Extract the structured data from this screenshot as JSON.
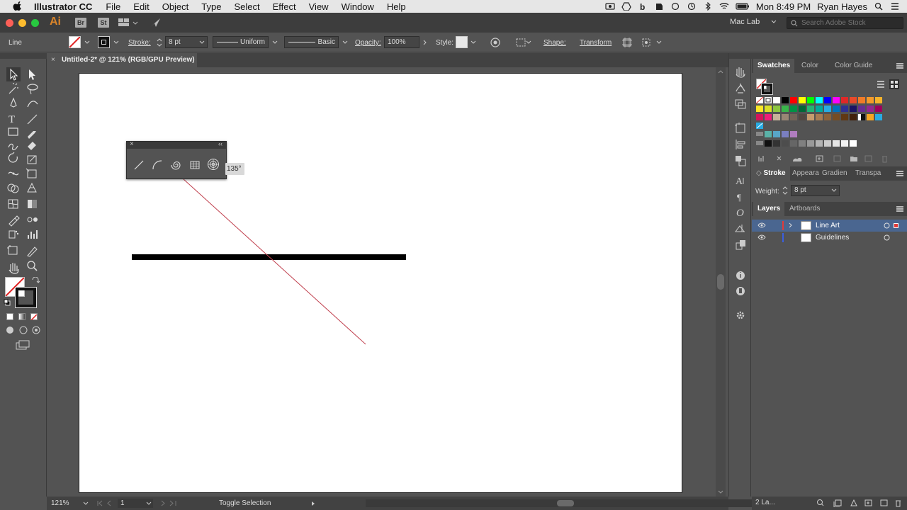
{
  "menubar": {
    "app_name": "Illustrator CC",
    "menus": [
      "File",
      "Edit",
      "Object",
      "Type",
      "Select",
      "Effect",
      "View",
      "Window",
      "Help"
    ],
    "clock": "Mon 8:49 PM",
    "user": "Ryan Hayes",
    "battery_icon": "battery-icon",
    "wifi_icon": "wifi-icon"
  },
  "appbar": {
    "logo": "Ai",
    "bridge": "Br",
    "stock": "St",
    "workspace": "Mac Lab",
    "search_placeholder": "Search Adobe Stock"
  },
  "controlbar": {
    "object_type": "Line",
    "stroke_label": "Stroke:",
    "stroke_value": "8 pt",
    "profile": "Uniform",
    "brush": "Basic",
    "opacity_label": "Opacity:",
    "opacity_value": "100%",
    "style_label": "Style:",
    "shape_label": "Shape:",
    "transform_label": "Transform"
  },
  "document": {
    "tab_title": "Untitled-2* @ 121% (RGB/GPU Preview)"
  },
  "flyout": {
    "angle_tip": "135°",
    "tools": [
      "line-segment-icon",
      "arc-icon",
      "spiral-icon",
      "rectangular-grid-icon",
      "polar-grid-icon"
    ]
  },
  "panels": {
    "swatches_tabs": [
      "Swatches",
      "Color",
      "Color Guide"
    ],
    "stroke_tabs": [
      "Stroke",
      "Appeara",
      "Gradien",
      "Transpa"
    ],
    "weight_label": "Weight:",
    "weight_value": "8 pt",
    "layers_tabs": [
      "Layers",
      "Artboards"
    ],
    "layers": [
      {
        "name": "Line Art",
        "color": "#e03a3a",
        "selected": true
      },
      {
        "name": "Guidelines",
        "color": "#3a5fe0",
        "selected": false
      }
    ],
    "layers_count": "2 La..."
  },
  "statusbar": {
    "zoom": "121%",
    "artboard_num": "1",
    "status_text": "Toggle Selection"
  },
  "colors": {
    "accent_orange": "#d9842a",
    "selected_layer": "#4a6690",
    "guide_line": "#c0404e"
  }
}
